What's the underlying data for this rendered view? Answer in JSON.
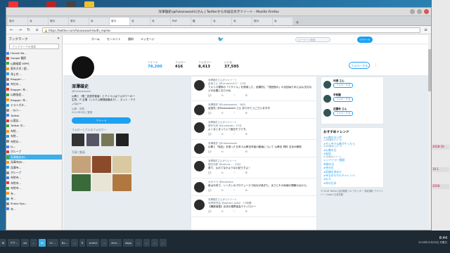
{
  "window": {
    "title": "深澤雄史(@fukasawashi)さん | Twitterからの返信付きツイート - Mozilla Firefox",
    "url": "https://twitter.com/fukasawashi/with_replies"
  },
  "tabs": [
    "窓口",
    "寺",
    "窓口",
    "窓口",
    "寺",
    "窓口",
    "寺",
    "寺",
    "PDF",
    "駿",
    "寺",
    "寺",
    "窓口",
    "寺"
  ],
  "sidebar": {
    "heading": "ブックマーク",
    "search_placeholder": "ブックマークを検索",
    "items": [
      "Hiroshi Ba...",
      "Google 翻訳",
      "仏教検索 MPPS",
      "東京大学 / 超...",
      "浄土宗 ...",
      "Blogger: ...",
      "寺社の...",
      "Blogger: 寺...",
      "仏教協会...",
      "Blogger: 寺...",
      "テストボタ...",
      "...仏(1...",
      "Twitter",
      "仏壇店...",
      "Twitter の...",
      "寺院...",
      "寺院...",
      "寺院の...",
      "仏...",
      "グループ",
      "深澤雄史@f...",
      "深澤寺@f...",
      "深澤寺...",
      "グループ",
      "寺院寺...",
      "寺院寺...",
      "寺院寺...",
      "寺...",
      "寺...",
      "Shoko Ega...",
      "寺..."
    ]
  },
  "twitter": {
    "nav": [
      "ホーム",
      "モーメント",
      "通知",
      "メッセージ"
    ],
    "search_placeholder": "キーワード検索",
    "tweet_button": "ツイート",
    "stats": [
      {
        "label": "ツイート",
        "value": "78,200"
      },
      {
        "label": "フォロー",
        "value": "416"
      },
      {
        "label": "フォロワー",
        "value": "8,413"
      },
      {
        "label": "いいね",
        "value": "37,595"
      }
    ],
    "follow_button": "フォローする",
    "profile": {
      "name": "深澤雄史",
      "handle": "@fukasawashi",
      "bio": "仏教と（第二言語学習者）とアイコンはフォロワーの一生的、IT 企業（システム開発経験あり）、ネット・テクノロジー",
      "meta1": "仏教・寺院",
      "meta2": "2012年5月に登録",
      "tweet_button": "ツイート",
      "followers_title": "フォローしているフォロワー",
      "photos_title": "写真と動画"
    },
    "tweets": [
      {
        "ctx": "深澤雄史さんがリツイート",
        "author": "倉田さん",
        "handle": "@Fumoto1017 · 11月",
        "text": "アメリカ発祥の「ミサイル」を使用した、結果的に「旅回復の」の出回ぬためには仏文化などが必要になりかね"
      },
      {
        "ctx": "",
        "author": "深澤雄史",
        "handle": "@fukasawashi · 36分",
        "text": "返信先: @fukasawashi さん ありがとうございます😊"
      },
      {
        "ctx": "深澤雄史さんがリツイート",
        "author": "優作元司",
        "handle": "@yusakudz · 57分",
        "text": "よくまとまっていて面白そうです。"
      },
      {
        "ctx": "",
        "author": "深澤雄史",
        "handle": "@fukasawashi",
        "text": "仏教と「仮定」を扱った日本人仏教法学者の動画について 仏教法 資料 文化の解説"
      },
      {
        "ctx": "深澤雄史さんがリツイート",
        "author": "櫻井光和",
        "handle": "@sakura... · 43分",
        "text": "原寸、仏れてなかようなの記ですよ！"
      },
      {
        "ctx": "",
        "author": "カゼバラ",
        "handle": "@kazebara",
        "text": "新は今何で、シーズンのプロデュースで地元が過ぎた。まさにその地域の理解の点から。"
      },
      {
        "ctx": "深澤雄史さんがリツイート",
        "author": "寺院研究会",
        "handle": "@gotoku_oshiji · 17時間",
        "text": "【職務演習】合流の推薦協会テクノロジー"
      }
    ],
    "tweet_actions": [
      "1",
      "3",
      "3"
    ],
    "suggestions": [
      {
        "name": "仲澤 さん",
        "handle": "@nakazawa",
        "btn": "フォローする"
      },
      {
        "name": "平和園",
        "handle": "@heiwaen",
        "btn": "フォローする"
      },
      {
        "name": "庄園寺 さん",
        "handle": "@shoenji",
        "btn": "フォローする"
      }
    ],
    "trends_title": "おすすめトレンド",
    "trends": [
      {
        "tag": "#仏教のない世",
        "count": "1,234件のツイート"
      },
      {
        "tag": "#ちじ寺で仏教がそったら",
        "count": "3,210件のツイート"
      },
      {
        "tag": "#仏教の日",
        "count": ""
      },
      {
        "tag": "#安倍",
        "count": "5.3万件のツイート"
      },
      {
        "tag": "レンドトラー開設",
        "count": ""
      },
      {
        "tag": "寺務の日",
        "count": ""
      },
      {
        "tag": "#寺の日",
        "count": ""
      },
      {
        "tag": "#同調を求めた",
        "count": ""
      },
      {
        "tag": "#寺なのもちもチャレンジ",
        "count": ""
      },
      {
        "tag": "#仏々",
        "count": ""
      },
      {
        "tag": "#寺の日本",
        "count": ""
      }
    ],
    "footer": "© 2018 Twitter 会社概要 ヘルプセンター 利用規約 プライバシー Cookie 広告情報"
  },
  "taskbar": {
    "items": [
      "アク...",
      "ad",
      "...",
      "ds",
      "12 ...",
      "Ba...",
      "...",
      "R",
      "xcleck",
      "...",
      "xfce...",
      "xbgo",
      "...",
      "...",
      "...",
      "..."
    ],
    "time": "8:44",
    "date": "2018年10月28日 月曜日"
  },
  "colors": {
    "twitter_blue": "#1da1f2",
    "selection": "#3daee9"
  }
}
